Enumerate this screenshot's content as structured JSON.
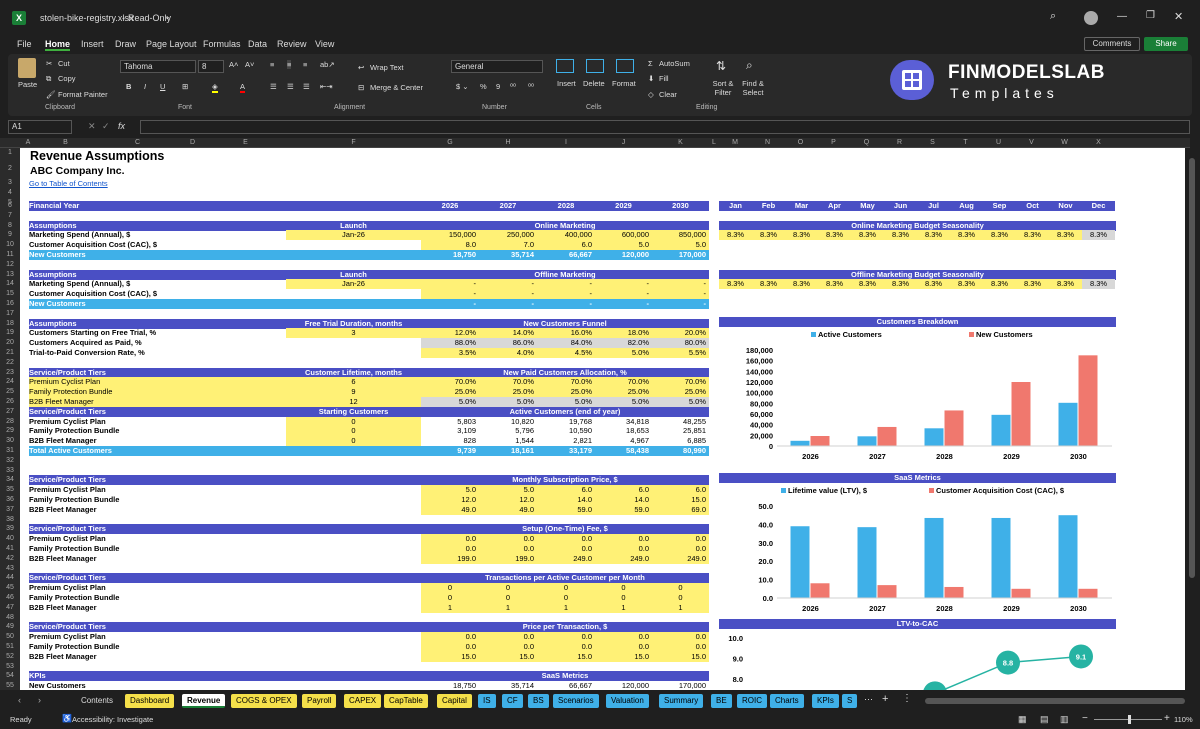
{
  "window": {
    "filename": "stolen-bike-registry.xlsx",
    "mode": "Read-Only"
  },
  "menu": [
    "File",
    "Home",
    "Insert",
    "Draw",
    "Page Layout",
    "Formulas",
    "Data",
    "Review",
    "View"
  ],
  "menu_active": "Home",
  "top_right": {
    "comments": "Comments",
    "share": "Share"
  },
  "ribbon": {
    "paste": "Paste",
    "cut": "Cut",
    "copy": "Copy",
    "format_painter": "Format Painter",
    "clipboard": "Clipboard",
    "font_name": "Tahoma",
    "font_size": "8",
    "font": "Font",
    "wrap_text": "Wrap Text",
    "merge_center": "Merge & Center",
    "alignment": "Alignment",
    "number_format": "General",
    "number": "Number",
    "insert": "Insert",
    "delete": "Delete",
    "format": "Format",
    "cells": "Cells",
    "autosum": "AutoSum",
    "fill": "Fill",
    "clear": "Clear",
    "sort_filter": "Sort & Filter",
    "find_select": "Find & Select",
    "editing": "Editing"
  },
  "logo": {
    "line1": "FINMODELSLAB",
    "line2": "Templates"
  },
  "name_box": "A1",
  "columns": [
    "A",
    "B",
    "C",
    "D",
    "E",
    "F",
    "G",
    "H",
    "I",
    "J",
    "K",
    "L",
    "M",
    "N",
    "O",
    "P",
    "Q",
    "R",
    "S",
    "T",
    "U",
    "V",
    "W",
    "X"
  ],
  "rows": [
    "1",
    "2",
    "3",
    "4",
    "5",
    "6",
    "7",
    "8",
    "9",
    "10",
    "11",
    "12",
    "13",
    "14",
    "15",
    "16",
    "17",
    "18",
    "19",
    "20",
    "21",
    "22",
    "23",
    "24",
    "25",
    "26",
    "27",
    "28",
    "29",
    "30",
    "31",
    "32",
    "33",
    "34",
    "35",
    "36",
    "37",
    "38",
    "39",
    "40",
    "41",
    "42",
    "43",
    "44",
    "45",
    "46",
    "47",
    "48",
    "49",
    "50",
    "51",
    "52",
    "53",
    "54",
    "55"
  ],
  "sheet": {
    "title": "Revenue Assumptions",
    "company": "ABC Company Inc.",
    "link": "Go to Table of Contents",
    "fy_label": "Financial Year",
    "years": [
      "2026",
      "2027",
      "2028",
      "2029",
      "2030"
    ],
    "months": [
      "Jan",
      "Feb",
      "Mar",
      "Apr",
      "May",
      "Jun",
      "Jul",
      "Aug",
      "Sep",
      "Oct",
      "Nov",
      "Dec"
    ],
    "online": {
      "assumptions": "Assumptions",
      "launch": "Launch",
      "section": "Online Marketing",
      "spend_label": "Marketing Spend (Annual), $",
      "launch_val": "Jan-26",
      "spend": [
        "150,000",
        "250,000",
        "400,000",
        "600,000",
        "850,000"
      ],
      "cac_label": "Customer Acquisition Cost (CAC), $",
      "cac": [
        "8.0",
        "7.0",
        "6.0",
        "5.0",
        "5.0"
      ],
      "new_label": "New Customers",
      "new": [
        "18,750",
        "35,714",
        "66,667",
        "120,000",
        "170,000"
      ],
      "season_title": "Online Marketing Budget Seasonality",
      "season": [
        "8.3%",
        "8.3%",
        "8.3%",
        "8.3%",
        "8.3%",
        "8.3%",
        "8.3%",
        "8.3%",
        "8.3%",
        "8.3%",
        "8.3%",
        "8.3%"
      ]
    },
    "offline": {
      "assumptions": "Assumptions",
      "launch": "Launch",
      "section": "Offline Marketing",
      "spend_label": "Marketing Spend (Annual), $",
      "launch_val": "Jan-26",
      "spend": [
        "-",
        "-",
        "-",
        "-",
        "-"
      ],
      "cac_label": "Customer Acquisition Cost (CAC), $",
      "cac": [
        "-",
        "-",
        "-",
        "-",
        "-"
      ],
      "new_label": "New Customers",
      "new": [
        "-",
        "-",
        "-",
        "-",
        "-"
      ],
      "season_title": "Offline Marketing Budget Seasonality",
      "season": [
        "8.3%",
        "8.3%",
        "8.3%",
        "8.3%",
        "8.3%",
        "8.3%",
        "8.3%",
        "8.3%",
        "8.3%",
        "8.3%",
        "8.3%",
        "8.3%"
      ]
    },
    "funnel": {
      "assumptions": "Assumptions",
      "trial_hdr": "Free Trial Duration, months",
      "section": "New Customers Funnel",
      "rows": [
        {
          "label": "Customers Starting on Free Trial, %",
          "mid": "3",
          "vals": [
            "12.0%",
            "14.0%",
            "16.0%",
            "18.0%",
            "20.0%"
          ]
        },
        {
          "label": "Customers Acquired as Paid, %",
          "mid": "",
          "vals": [
            "88.0%",
            "86.0%",
            "84.0%",
            "82.0%",
            "80.0%"
          ]
        },
        {
          "label": "Trial-to-Paid Conversion Rate, %",
          "mid": "",
          "vals": [
            "3.5%",
            "4.0%",
            "4.5%",
            "5.0%",
            "5.5%"
          ]
        }
      ]
    },
    "alloc": {
      "tiers": "Service/Product Tiers",
      "life_hdr": "Customer Lifetime, months",
      "section": "New Paid Customers Allocation, %",
      "rows": [
        {
          "label": "Premium Cyclist Plan",
          "mid": "6",
          "vals": [
            "70.0%",
            "70.0%",
            "70.0%",
            "70.0%",
            "70.0%"
          ]
        },
        {
          "label": "Family Protection Bundle",
          "mid": "9",
          "vals": [
            "25.0%",
            "25.0%",
            "25.0%",
            "25.0%",
            "25.0%"
          ]
        },
        {
          "label": "B2B Fleet Manager",
          "mid": "12",
          "vals": [
            "5.0%",
            "5.0%",
            "5.0%",
            "5.0%",
            "5.0%"
          ]
        }
      ]
    },
    "active": {
      "tiers": "Service/Product Tiers",
      "start_hdr": "Starting Customers",
      "section": "Active Customers (end of year)",
      "rows": [
        {
          "label": "Premium Cyclist Plan",
          "mid": "0",
          "vals": [
            "5,803",
            "10,820",
            "19,768",
            "34,818",
            "48,255"
          ]
        },
        {
          "label": "Family Protection Bundle",
          "mid": "0",
          "vals": [
            "3,109",
            "5,796",
            "10,590",
            "18,653",
            "25,851"
          ]
        },
        {
          "label": "B2B Fleet Manager",
          "mid": "0",
          "vals": [
            "828",
            "1,544",
            "2,821",
            "4,967",
            "6,885"
          ]
        }
      ],
      "total_label": "Total Active Customers",
      "total": [
        "9,739",
        "18,161",
        "33,179",
        "58,438",
        "80,990"
      ]
    },
    "price": {
      "tiers": "Service/Product Tiers",
      "section": "Monthly Subscription Price, $",
      "rows": [
        {
          "label": "Premium Cyclist Plan",
          "vals": [
            "5.0",
            "5.0",
            "6.0",
            "6.0",
            "6.0"
          ]
        },
        {
          "label": "Family Protection Bundle",
          "vals": [
            "12.0",
            "12.0",
            "14.0",
            "14.0",
            "15.0"
          ]
        },
        {
          "label": "B2B Fleet Manager",
          "vals": [
            "49.0",
            "49.0",
            "59.0",
            "59.0",
            "69.0"
          ]
        }
      ]
    },
    "setup": {
      "tiers": "Service/Product Tiers",
      "section": "Setup (One-Time) Fee, $",
      "rows": [
        {
          "label": "Premium Cyclist Plan",
          "vals": [
            "0.0",
            "0.0",
            "0.0",
            "0.0",
            "0.0"
          ]
        },
        {
          "label": "Family Protection Bundle",
          "vals": [
            "0.0",
            "0.0",
            "0.0",
            "0.0",
            "0.0"
          ]
        },
        {
          "label": "B2B Fleet Manager",
          "vals": [
            "199.0",
            "199.0",
            "249.0",
            "249.0",
            "249.0"
          ]
        }
      ]
    },
    "txn": {
      "tiers": "Service/Product Tiers",
      "section": "Transactions per Active Customer per Month",
      "rows": [
        {
          "label": "Premium Cyclist Plan",
          "vals": [
            "0",
            "0",
            "0",
            "0",
            "0"
          ]
        },
        {
          "label": "Family Protection Bundle",
          "vals": [
            "0",
            "0",
            "0",
            "0",
            "0"
          ]
        },
        {
          "label": "B2B Fleet Manager",
          "vals": [
            "1",
            "1",
            "1",
            "1",
            "1"
          ]
        }
      ]
    },
    "ppt": {
      "tiers": "Service/Product Tiers",
      "section": "Price per Transaction, $",
      "rows": [
        {
          "label": "Premium Cyclist Plan",
          "vals": [
            "0.0",
            "0.0",
            "0.0",
            "0.0",
            "0.0"
          ]
        },
        {
          "label": "Family Protection Bundle",
          "vals": [
            "0.0",
            "0.0",
            "0.0",
            "0.0",
            "0.0"
          ]
        },
        {
          "label": "B2B Fleet Manager",
          "vals": [
            "15.0",
            "15.0",
            "15.0",
            "15.0",
            "15.0"
          ]
        }
      ]
    },
    "kpis": {
      "label": "KPIs",
      "section": "SaaS Metrics",
      "new_label": "New Customers",
      "new": [
        "18,750",
        "35,714",
        "66,667",
        "120,000",
        "170,000"
      ]
    }
  },
  "chart_data": [
    {
      "type": "bar",
      "title": "Customers Breakdown",
      "categories": [
        "2026",
        "2027",
        "2028",
        "2029",
        "2030"
      ],
      "ylim": [
        0,
        180000
      ],
      "yticks": [
        "180,000",
        "160,000",
        "140,000",
        "120,000",
        "100,000",
        "80,000",
        "60,000",
        "40,000",
        "20,000",
        "0"
      ],
      "series": [
        {
          "name": "Active Customers",
          "color": "#3fb0e8",
          "values": [
            9739,
            18161,
            33179,
            58438,
            80990
          ]
        },
        {
          "name": "New Customers",
          "color": "#f0786e",
          "values": [
            18750,
            35714,
            66667,
            120000,
            170000
          ]
        }
      ]
    },
    {
      "type": "bar",
      "title": "SaaS Metrics",
      "categories": [
        "2026",
        "2027",
        "2028",
        "2029",
        "2030"
      ],
      "ylim": [
        0,
        50
      ],
      "yticks": [
        "50.0",
        "40.0",
        "30.0",
        "20.0",
        "10.0",
        "0.0"
      ],
      "series": [
        {
          "name": "Lifetime value (LTV), $",
          "color": "#3fb0e8",
          "values": [
            39,
            38.5,
            43.5,
            43.5,
            45
          ]
        },
        {
          "name": "Customer Acquisition Cost (CAC), $",
          "color": "#f0786e",
          "values": [
            8.0,
            7.0,
            6.0,
            5.0,
            5.0
          ]
        }
      ]
    },
    {
      "type": "line",
      "title": "LTV-to-CAC",
      "categories": [
        "2026",
        "2027",
        "2028",
        "2029",
        "2030"
      ],
      "ylim": [
        6.0,
        10.0
      ],
      "yticks": [
        "10.0",
        "9.0",
        "8.0",
        "7.0",
        "6.0"
      ],
      "series": [
        {
          "color": "#26b3a3",
          "values": [
            4.9,
            5.5,
            7.3,
            8.8,
            9.1
          ]
        }
      ],
      "labels": [
        "5.5",
        "7.3",
        "8.8",
        "9.1"
      ]
    }
  ],
  "tabs": [
    {
      "label": "Contents",
      "style": "d"
    },
    {
      "label": "Dashboard",
      "style": "y"
    },
    {
      "label": "Revenue",
      "style": "p"
    },
    {
      "label": "COGS & OPEX",
      "style": "y"
    },
    {
      "label": "Payroll",
      "style": "y"
    },
    {
      "label": "CAPEX",
      "style": "y"
    },
    {
      "label": "CapTable",
      "style": "y"
    },
    {
      "label": "Capital",
      "style": "y"
    },
    {
      "label": "IS",
      "style": "b"
    },
    {
      "label": "CF",
      "style": "b"
    },
    {
      "label": "BS",
      "style": "b"
    },
    {
      "label": "Scenarios",
      "style": "b"
    },
    {
      "label": "Valuation",
      "style": "b"
    },
    {
      "label": "Summary",
      "style": "b"
    },
    {
      "label": "BE",
      "style": "b"
    },
    {
      "label": "ROIC",
      "style": "b"
    },
    {
      "label": "Charts",
      "style": "b"
    },
    {
      "label": "KPIs",
      "style": "b"
    },
    {
      "label": "S",
      "style": "b"
    }
  ],
  "status": {
    "ready": "Ready",
    "accessibility": "Accessibility: Investigate",
    "zoom": "110%"
  }
}
